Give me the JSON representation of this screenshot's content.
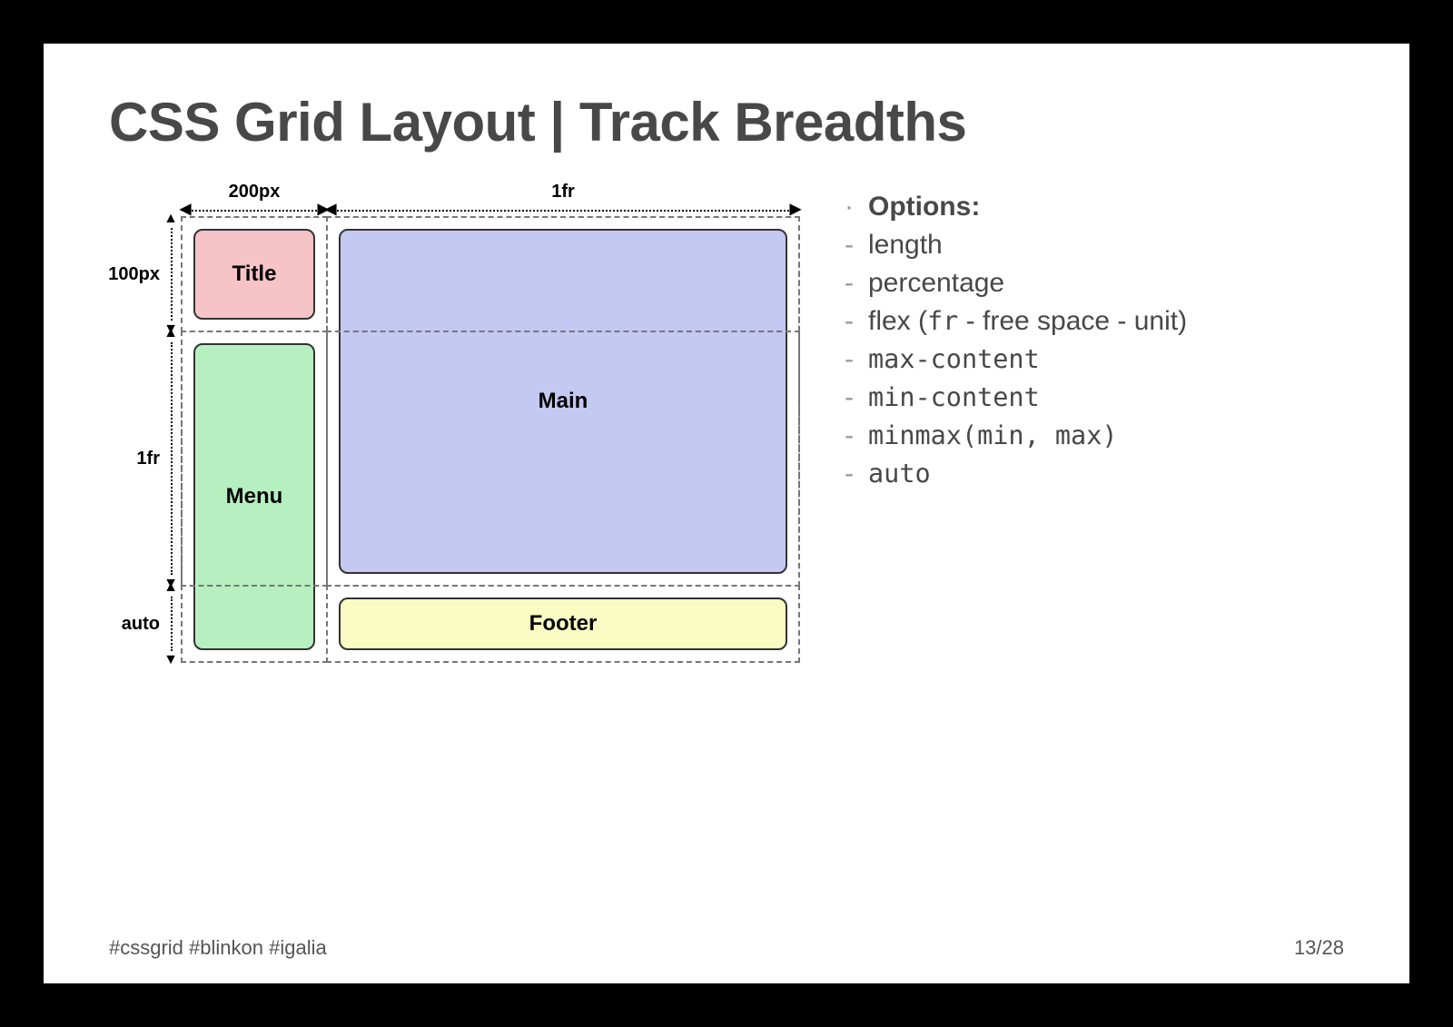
{
  "slide": {
    "title": "CSS Grid Layout | Track Breadths",
    "hashtags": "#cssgrid #blinkon #igalia",
    "pageIndicator": "13/28"
  },
  "diagram": {
    "colLabels": [
      "200px",
      "1fr"
    ],
    "rowLabels": [
      "100px",
      "1fr",
      "auto"
    ],
    "boxes": {
      "title": "Title",
      "menu": "Menu",
      "main": "Main",
      "footer": "Footer"
    }
  },
  "options": {
    "heading": "Options:",
    "items": [
      {
        "text": "length"
      },
      {
        "text": "percentage"
      },
      {
        "text_before": "flex (",
        "code": "fr",
        "text_after": " - free space - unit)"
      },
      {
        "code": "max-content"
      },
      {
        "code": "min-content"
      },
      {
        "code": "minmax(min, max)"
      },
      {
        "code": "auto"
      }
    ]
  }
}
